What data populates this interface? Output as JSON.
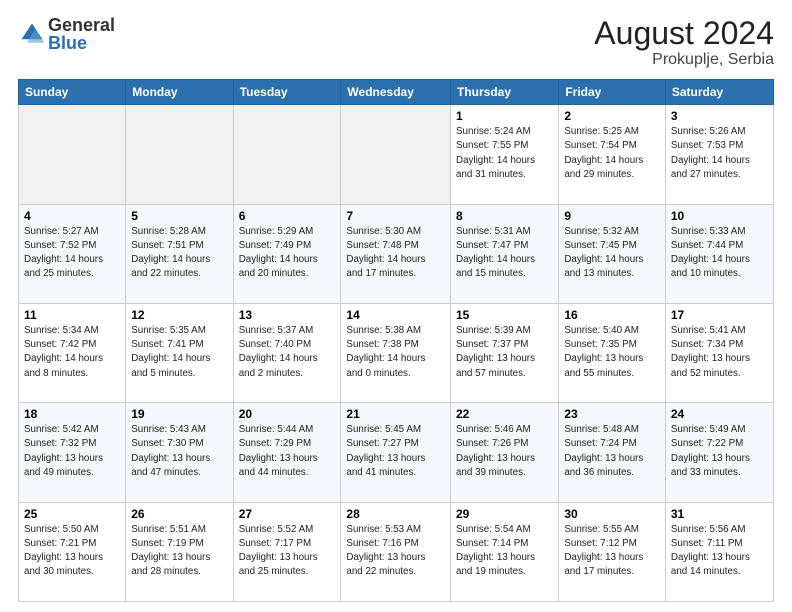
{
  "header": {
    "logo_general": "General",
    "logo_blue": "Blue",
    "month_title": "August 2024",
    "location": "Prokuplje, Serbia"
  },
  "weekdays": [
    "Sunday",
    "Monday",
    "Tuesday",
    "Wednesday",
    "Thursday",
    "Friday",
    "Saturday"
  ],
  "weeks": [
    [
      {
        "day": "",
        "info": ""
      },
      {
        "day": "",
        "info": ""
      },
      {
        "day": "",
        "info": ""
      },
      {
        "day": "",
        "info": ""
      },
      {
        "day": "1",
        "info": "Sunrise: 5:24 AM\nSunset: 7:55 PM\nDaylight: 14 hours\nand 31 minutes."
      },
      {
        "day": "2",
        "info": "Sunrise: 5:25 AM\nSunset: 7:54 PM\nDaylight: 14 hours\nand 29 minutes."
      },
      {
        "day": "3",
        "info": "Sunrise: 5:26 AM\nSunset: 7:53 PM\nDaylight: 14 hours\nand 27 minutes."
      }
    ],
    [
      {
        "day": "4",
        "info": "Sunrise: 5:27 AM\nSunset: 7:52 PM\nDaylight: 14 hours\nand 25 minutes."
      },
      {
        "day": "5",
        "info": "Sunrise: 5:28 AM\nSunset: 7:51 PM\nDaylight: 14 hours\nand 22 minutes."
      },
      {
        "day": "6",
        "info": "Sunrise: 5:29 AM\nSunset: 7:49 PM\nDaylight: 14 hours\nand 20 minutes."
      },
      {
        "day": "7",
        "info": "Sunrise: 5:30 AM\nSunset: 7:48 PM\nDaylight: 14 hours\nand 17 minutes."
      },
      {
        "day": "8",
        "info": "Sunrise: 5:31 AM\nSunset: 7:47 PM\nDaylight: 14 hours\nand 15 minutes."
      },
      {
        "day": "9",
        "info": "Sunrise: 5:32 AM\nSunset: 7:45 PM\nDaylight: 14 hours\nand 13 minutes."
      },
      {
        "day": "10",
        "info": "Sunrise: 5:33 AM\nSunset: 7:44 PM\nDaylight: 14 hours\nand 10 minutes."
      }
    ],
    [
      {
        "day": "11",
        "info": "Sunrise: 5:34 AM\nSunset: 7:42 PM\nDaylight: 14 hours\nand 8 minutes."
      },
      {
        "day": "12",
        "info": "Sunrise: 5:35 AM\nSunset: 7:41 PM\nDaylight: 14 hours\nand 5 minutes."
      },
      {
        "day": "13",
        "info": "Sunrise: 5:37 AM\nSunset: 7:40 PM\nDaylight: 14 hours\nand 2 minutes."
      },
      {
        "day": "14",
        "info": "Sunrise: 5:38 AM\nSunset: 7:38 PM\nDaylight: 14 hours\nand 0 minutes."
      },
      {
        "day": "15",
        "info": "Sunrise: 5:39 AM\nSunset: 7:37 PM\nDaylight: 13 hours\nand 57 minutes."
      },
      {
        "day": "16",
        "info": "Sunrise: 5:40 AM\nSunset: 7:35 PM\nDaylight: 13 hours\nand 55 minutes."
      },
      {
        "day": "17",
        "info": "Sunrise: 5:41 AM\nSunset: 7:34 PM\nDaylight: 13 hours\nand 52 minutes."
      }
    ],
    [
      {
        "day": "18",
        "info": "Sunrise: 5:42 AM\nSunset: 7:32 PM\nDaylight: 13 hours\nand 49 minutes."
      },
      {
        "day": "19",
        "info": "Sunrise: 5:43 AM\nSunset: 7:30 PM\nDaylight: 13 hours\nand 47 minutes."
      },
      {
        "day": "20",
        "info": "Sunrise: 5:44 AM\nSunset: 7:29 PM\nDaylight: 13 hours\nand 44 minutes."
      },
      {
        "day": "21",
        "info": "Sunrise: 5:45 AM\nSunset: 7:27 PM\nDaylight: 13 hours\nand 41 minutes."
      },
      {
        "day": "22",
        "info": "Sunrise: 5:46 AM\nSunset: 7:26 PM\nDaylight: 13 hours\nand 39 minutes."
      },
      {
        "day": "23",
        "info": "Sunrise: 5:48 AM\nSunset: 7:24 PM\nDaylight: 13 hours\nand 36 minutes."
      },
      {
        "day": "24",
        "info": "Sunrise: 5:49 AM\nSunset: 7:22 PM\nDaylight: 13 hours\nand 33 minutes."
      }
    ],
    [
      {
        "day": "25",
        "info": "Sunrise: 5:50 AM\nSunset: 7:21 PM\nDaylight: 13 hours\nand 30 minutes."
      },
      {
        "day": "26",
        "info": "Sunrise: 5:51 AM\nSunset: 7:19 PM\nDaylight: 13 hours\nand 28 minutes."
      },
      {
        "day": "27",
        "info": "Sunrise: 5:52 AM\nSunset: 7:17 PM\nDaylight: 13 hours\nand 25 minutes."
      },
      {
        "day": "28",
        "info": "Sunrise: 5:53 AM\nSunset: 7:16 PM\nDaylight: 13 hours\nand 22 minutes."
      },
      {
        "day": "29",
        "info": "Sunrise: 5:54 AM\nSunset: 7:14 PM\nDaylight: 13 hours\nand 19 minutes."
      },
      {
        "day": "30",
        "info": "Sunrise: 5:55 AM\nSunset: 7:12 PM\nDaylight: 13 hours\nand 17 minutes."
      },
      {
        "day": "31",
        "info": "Sunrise: 5:56 AM\nSunset: 7:11 PM\nDaylight: 13 hours\nand 14 minutes."
      }
    ]
  ]
}
